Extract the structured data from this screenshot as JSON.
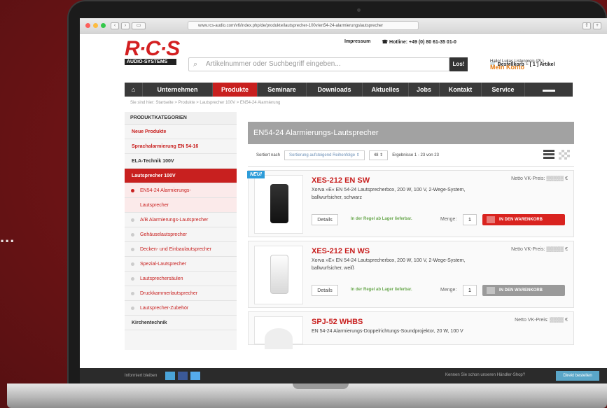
{
  "browser": {
    "url": "www.rcs-audio.com/v6/index.php/de/produkte/lautsprecher-100v/en54-24-alarmierungslautsprecher"
  },
  "header": {
    "logo_text": "R·C·S",
    "logo_sub": "AUDIO-SYSTEMS",
    "impressum": "Impressum",
    "hotline": "Hotline: +49 (0) 80 61-35 01-0",
    "cart": "Bestellkorb – [ 1 ] Artikel",
    "greeting": "Hallo! Lukas Listenpreis (PL)",
    "account": "Mein Konto",
    "search_placeholder": "Artikelnummer oder Suchbegriff eingeben...",
    "search_button": "Los!"
  },
  "nav": {
    "items": [
      "Unternehmen",
      "Produkte",
      "Seminare",
      "Downloads",
      "Aktuelles",
      "Jobs",
      "Kontakt",
      "Service"
    ]
  },
  "breadcrumb": "Sie sind hier: Startseite > Produkte > Lautsprecher 100V > EN54-24 Alarmierung",
  "sidebar": {
    "heading": "PRODUKTKATEGORIEN",
    "items": [
      "Neue Produkte",
      "Sprachalarmierung EN 54-16",
      "ELA-Technik 100V",
      "Lautsprecher 100V"
    ],
    "subitems": [
      "EN54-24 Alarmierungs-",
      "Lautsprecher",
      "A/B Alarmierungs-Lautsprecher",
      "Gehäuselautsprecher",
      "Decken- und Einbaulautsprecher",
      "Spezial-Lautsprecher",
      "Lautsprechersäulen",
      "Druckkammerlautsprecher",
      "Lautsprecher-Zubehör"
    ],
    "last": "Kirchentechnik"
  },
  "content": {
    "title": "EN54-24 Alarmierungs-Lautsprecher",
    "sort_label": "Sortiert nach",
    "sort_value": "Sortierung aufsteigend Reihenfolge",
    "per_page": "48",
    "results": "Ergebnisse 1 - 23 von 23"
  },
  "products": [
    {
      "badge": "NEU!",
      "name": "XES-212 EN SW",
      "desc": "Xorva »E« EN 54-24 Lautsprecherbox, 200 W, 100 V, 2-Wege-System, ballwurfsicher, schwarz",
      "price_label": "Netto VK-Preis:",
      "price": "€",
      "details": "Details",
      "availability": "In der Regel ab Lager lieferbar.",
      "menge": "Menge:",
      "qty": "1",
      "cart_button": "IN DEN WARENKORB"
    },
    {
      "name": "XES-212 EN WS",
      "desc": "Xorva »E« EN 54-24 Lautsprecherbox, 200 W, 100 V, 2-Wege-System, ballwurfsicher, weiß",
      "price_label": "Netto VK-Preis:",
      "price": "€",
      "details": "Details",
      "availability": "In der Regel ab Lager lieferbar.",
      "menge": "Menge:",
      "qty": "1",
      "cart_button": "IN DEN WARENKORB"
    },
    {
      "name": "SPJ-52 WHBS",
      "desc": "EN 54-24 Alarmierungs-Doppelrichtungs-Soundprojektor, 20 W, 100 V",
      "price_label": "Netto VK-Preis:",
      "price": "€"
    }
  ],
  "footer": {
    "informed": "Informiert bleiben",
    "shop_question": "Kennen Sie schon unseren Händler-Shop?",
    "shop_button": "Direkt bestellen"
  },
  "ellipsis": "..."
}
